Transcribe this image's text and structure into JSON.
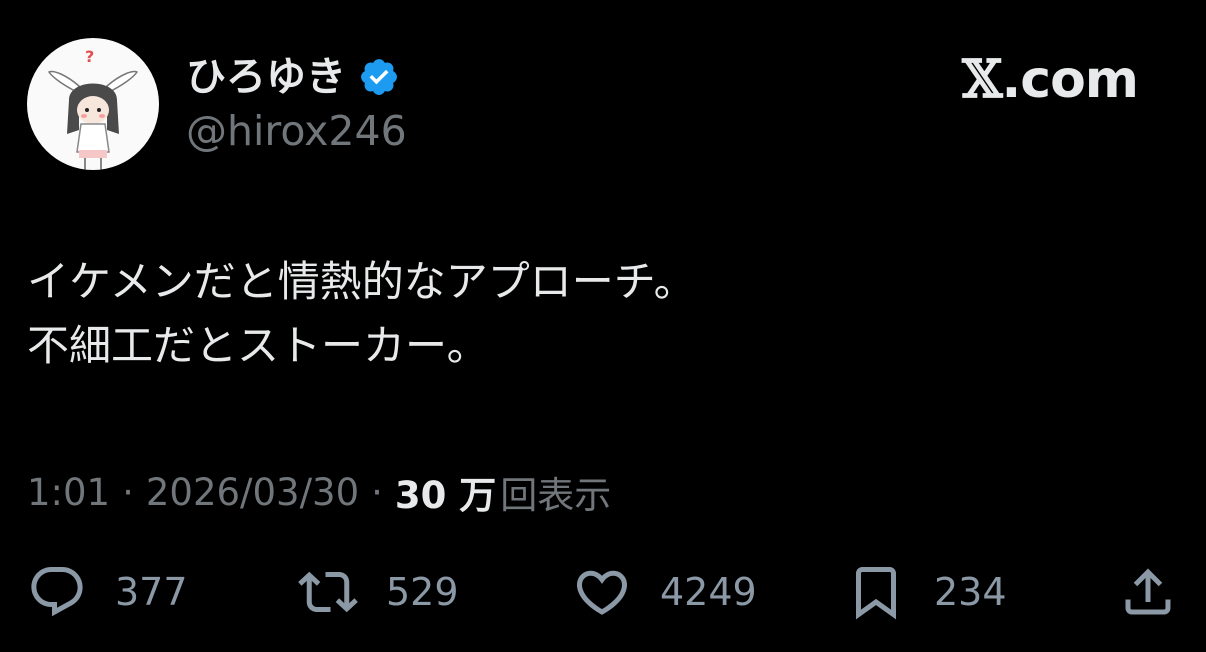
{
  "author": {
    "display_name": "ひろゆき",
    "handle": "@hirox246",
    "verified": true,
    "avatar_icon": "bunny-ear-girl-avatar"
  },
  "brand": {
    "x_glyph": "𝕏",
    "domain": ".com"
  },
  "tweet": {
    "lines": [
      "イケメンだと情熱的なアプローチ。",
      "不細工だとストーカー。"
    ]
  },
  "meta": {
    "time": "1:01",
    "separator": "·",
    "date": "2026/03/30",
    "views_count": "30 万",
    "views_label": "回表示"
  },
  "actions": {
    "reply": {
      "icon": "reply-icon",
      "count": "377"
    },
    "repost": {
      "icon": "repost-icon",
      "count": "529"
    },
    "like": {
      "icon": "heart-icon",
      "count": "4249"
    },
    "bookmark": {
      "icon": "bookmark-icon",
      "count": "234"
    },
    "share": {
      "icon": "share-icon"
    }
  },
  "colors": {
    "background": "#000000",
    "primary_text": "#e7e9ea",
    "secondary_text": "#71767b",
    "verified_blue": "#1d9bf0"
  }
}
